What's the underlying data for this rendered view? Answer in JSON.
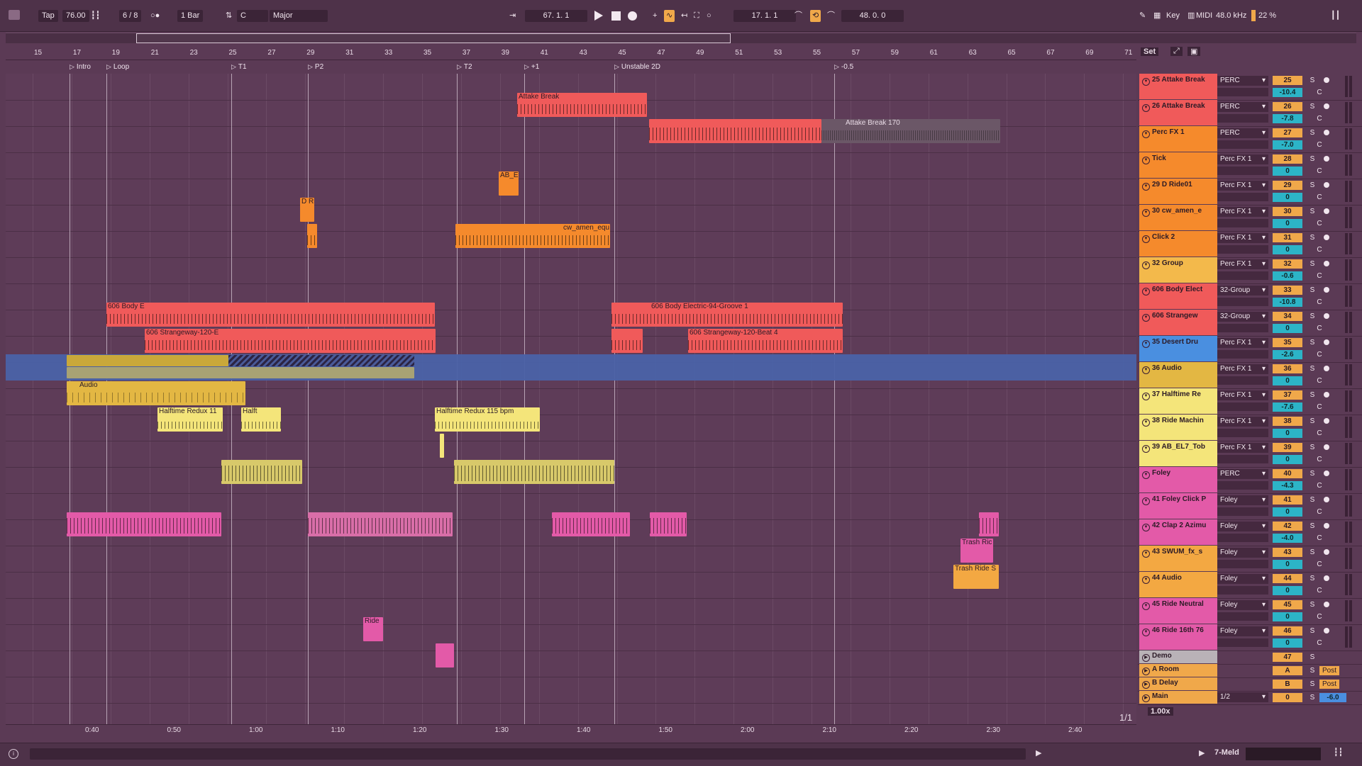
{
  "transport": {
    "tap_label": "Tap",
    "tempo": "76.00",
    "time_signature": "6 / 8",
    "quantize": "1 Bar",
    "key_root": "C",
    "scale": "Major",
    "arrangement_position": "67.  1.  1",
    "loop_start": "17.  1.  1",
    "loop_length": "48.  0.  0",
    "key_label": "Key",
    "midi_label": "MIDI",
    "sample_rate": "48.0 kHz",
    "cpu": "22 %"
  },
  "arrangement": {
    "bar_numbers": [
      "15",
      "17",
      "19",
      "21",
      "23",
      "25",
      "27",
      "29",
      "31",
      "33",
      "35",
      "37",
      "39",
      "41",
      "43",
      "45",
      "47",
      "49",
      "51",
      "53",
      "55",
      "57",
      "59",
      "61",
      "63",
      "65",
      "67",
      "69",
      "71"
    ],
    "locators": [
      "Intro",
      "Loop",
      "T1",
      "P2",
      "T2",
      "+1",
      "Unstable 2D",
      "-0.5"
    ],
    "set_label": "Set",
    "page_indicator": "1/1",
    "zoom": "1.00x",
    "time_labels": [
      "0:40",
      "0:50",
      "1:00",
      "1:10",
      "1:20",
      "1:30",
      "1:40",
      "1:50",
      "2:00",
      "2:10",
      "2:20",
      "2:30",
      "2:40"
    ],
    "clips": {
      "attake_a": "Attake Break",
      "attake_b": "Attake Break 170",
      "ab_e": "AB_E",
      "d_ri": "D Ri",
      "cw_amen": "cw_amen_equ",
      "body_e": "606 Body Electric-94-Groove 1",
      "body_short": "606 Body E",
      "strangeway": "606 Strangeway-120-Beat 4",
      "strangeway_short": "606 Strangeway-120-E",
      "audio": "Audio",
      "halftime_a": "Halftime Redux 11",
      "halftime_b": "Halftime Redux 115 bpm",
      "halft": "Halft",
      "trash_ride": "Trash Ride S",
      "trash_ric": "Trash Ric",
      "ride": "Ride"
    }
  },
  "tracks": [
    {
      "name": "25 Attake Break",
      "route": "PERC",
      "num": "25",
      "vol": "-10.4",
      "color": "#f05a5a"
    },
    {
      "name": "26 Attake Break",
      "route": "PERC",
      "num": "26",
      "vol": "-7.8",
      "color": "#f05a5a"
    },
    {
      "name": "Perc FX 1",
      "route": "PERC",
      "num": "27",
      "vol": "-7.0",
      "color": "#f58a2c"
    },
    {
      "name": "Tick",
      "route": "Perc FX 1",
      "num": "28",
      "vol": "0",
      "color": "#f58a2c"
    },
    {
      "name": "29 D Ride01",
      "route": "Perc FX 1",
      "num": "29",
      "vol": "0",
      "color": "#f58a2c"
    },
    {
      "name": "30 cw_amen_e",
      "route": "Perc FX 1",
      "num": "30",
      "vol": "0",
      "color": "#f58a2c"
    },
    {
      "name": "Click 2",
      "route": "Perc FX 1",
      "num": "31",
      "vol": "0",
      "color": "#f58a2c"
    },
    {
      "name": "32 Group",
      "route": "Perc FX 1",
      "num": "32",
      "vol": "-0.6",
      "color": "#f3b94b"
    },
    {
      "name": "606 Body Elect",
      "route": "32-Group",
      "num": "33",
      "vol": "-10.8",
      "color": "#f05a5a"
    },
    {
      "name": "606 Strangew",
      "route": "32-Group",
      "num": "34",
      "vol": "0",
      "color": "#f05a5a"
    },
    {
      "name": "35 Desert Dru",
      "route": "Perc FX 1",
      "num": "35",
      "vol": "-2.6",
      "color": "#4a8fe0"
    },
    {
      "name": "36 Audio",
      "route": "Perc FX 1",
      "num": "36",
      "vol": "0",
      "color": "#e3b743"
    },
    {
      "name": "37 Halftime Re",
      "route": "Perc FX 1",
      "num": "37",
      "vol": "-7.6",
      "color": "#f4e57a"
    },
    {
      "name": "38 Ride Machin",
      "route": "Perc FX 1",
      "num": "38",
      "vol": "0",
      "color": "#f4e57a"
    },
    {
      "name": "39 AB_EL7_Tob",
      "route": "Perc FX 1",
      "num": "39",
      "vol": "0",
      "color": "#f4e57a"
    },
    {
      "name": "Foley",
      "route": "PERC",
      "num": "40",
      "vol": "-4.3",
      "color": "#e35aa8"
    },
    {
      "name": "41 Foley Click P",
      "route": "Foley",
      "num": "41",
      "vol": "0",
      "color": "#e35aa8"
    },
    {
      "name": "42 Clap 2 Azimu",
      "route": "Foley",
      "num": "42",
      "vol": "-4.0",
      "color": "#e35aa8"
    },
    {
      "name": "43 SWUM_fx_s",
      "route": "Foley",
      "num": "43",
      "vol": "0",
      "color": "#f3a842"
    },
    {
      "name": "44 Audio",
      "route": "Foley",
      "num": "44",
      "vol": "0",
      "color": "#f3a842"
    },
    {
      "name": "45 Ride Neutral",
      "route": "Foley",
      "num": "45",
      "vol": "0",
      "color": "#e35aa8"
    },
    {
      "name": "46 Ride 16th 76",
      "route": "Foley",
      "num": "46",
      "vol": "0",
      "color": "#e35aa8"
    }
  ],
  "returns": [
    {
      "name": "Demo",
      "num": "47",
      "color": "#b9b2b7"
    },
    {
      "name": "A Room",
      "num": "A",
      "color": "#f0a84a"
    },
    {
      "name": "B Delay",
      "num": "B",
      "color": "#f0a84a"
    },
    {
      "name": "Main",
      "num": "0",
      "route": "1/2",
      "vol": "-6.0",
      "color": "#f0a84a"
    }
  ],
  "mixer_labels": {
    "solo": "S",
    "pan": "C",
    "post": "Post"
  },
  "status": {
    "device": "7-Meld"
  }
}
